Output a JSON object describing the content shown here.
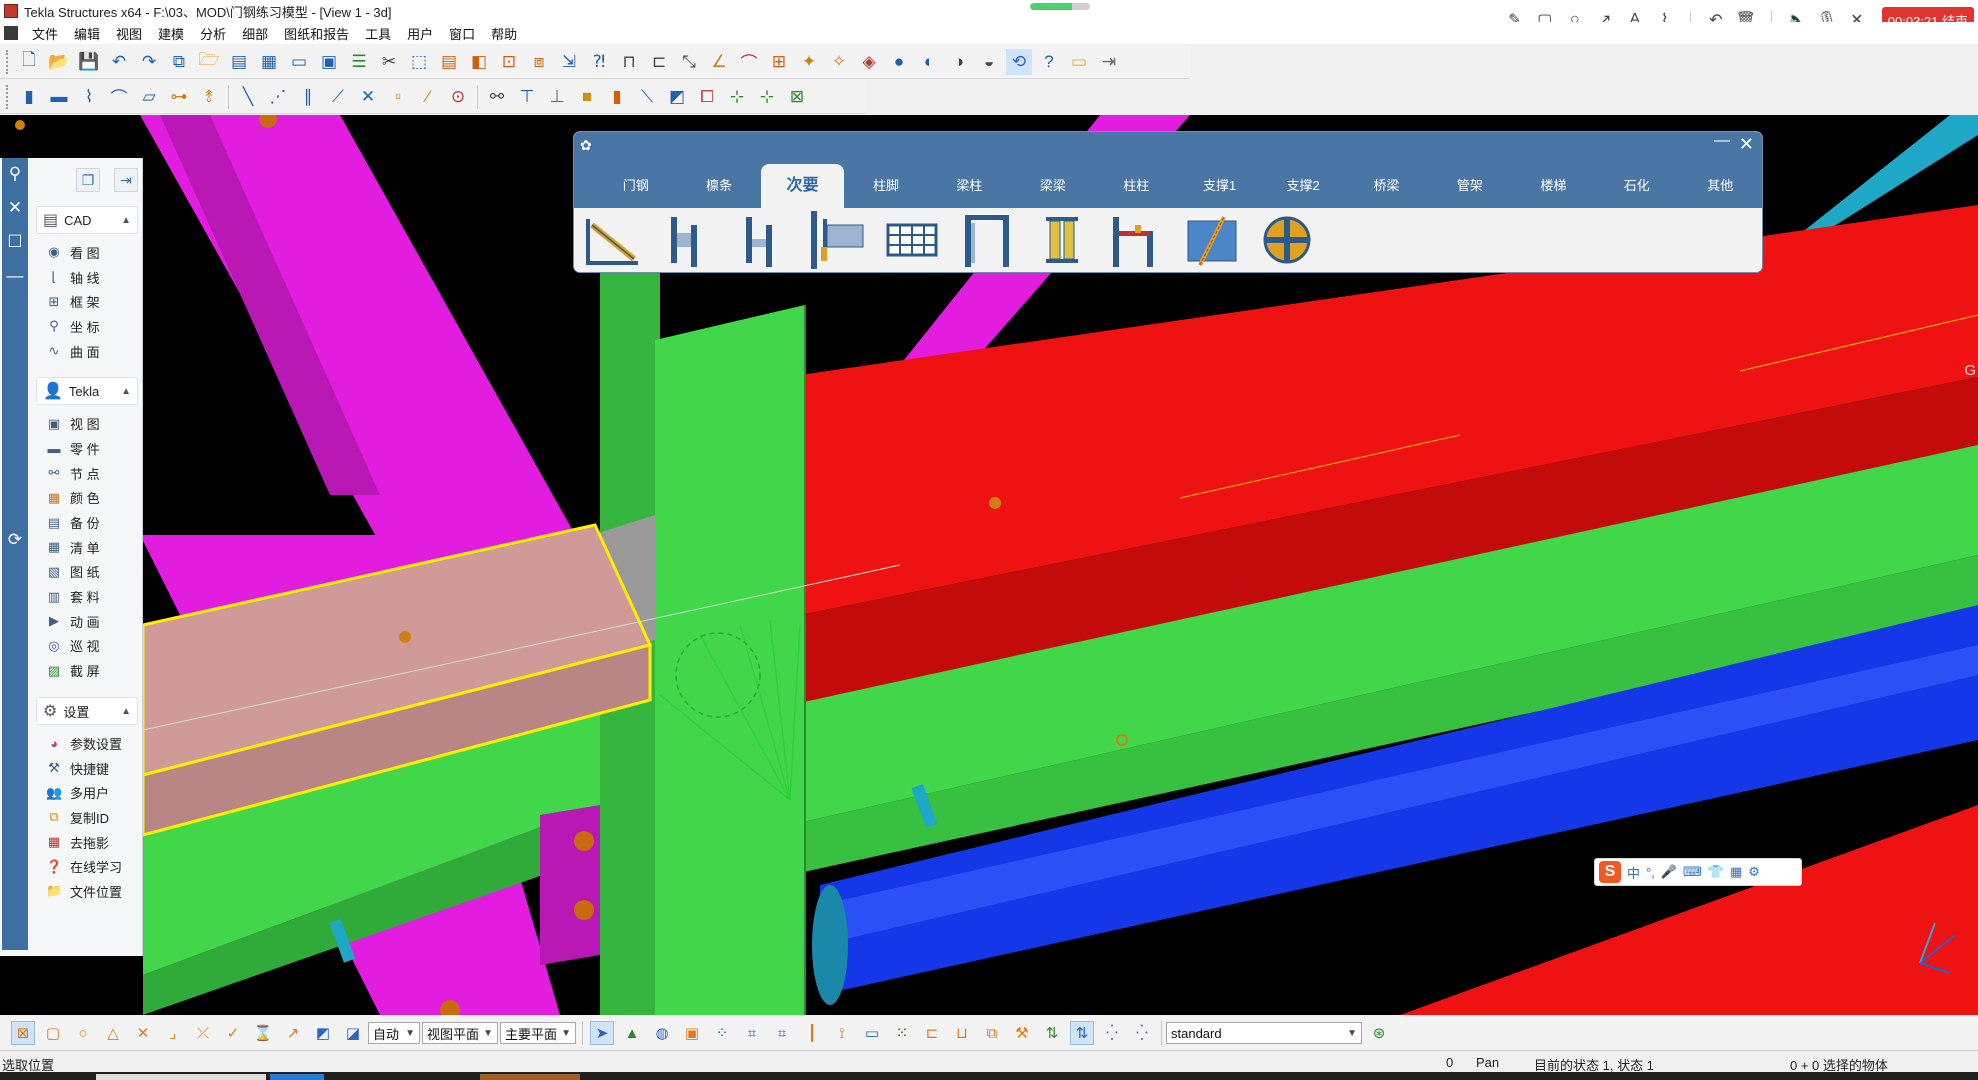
{
  "window": {
    "title": "Tekla Structures x64 - F:\\03、MOD\\门钢练习模型  - [View 1 - 3d]"
  },
  "recorder": {
    "tools": [
      "pen-icon",
      "rectangle-icon",
      "circle-icon",
      "arrow-icon",
      "text-icon",
      "highlighter-icon",
      "undo-icon",
      "trash-icon",
      "speaker-icon",
      "microphone-icon",
      "close-icon"
    ],
    "timer": "00:03:21 结束"
  },
  "menubar": {
    "items": [
      "文件",
      "编辑",
      "视图",
      "建模",
      "分析",
      "细部",
      "图纸和报告",
      "工具",
      "用户",
      "窗口",
      "帮助"
    ]
  },
  "sidebar": {
    "strip_buttons": [
      "pin-icon",
      "close-icon",
      "restore-icon",
      "minimize-icon",
      "refresh-icon"
    ],
    "groups": [
      {
        "title": "CAD",
        "items": [
          {
            "label": "看 图",
            "icon": "eye-icon"
          },
          {
            "label": "轴 线",
            "icon": "axis-icon"
          },
          {
            "label": "框 架",
            "icon": "frame-icon"
          },
          {
            "label": "坐 标",
            "icon": "location-pin-icon"
          },
          {
            "label": "曲 面",
            "icon": "curve-icon"
          }
        ]
      },
      {
        "title": "Tekla",
        "items": [
          {
            "label": "视 图",
            "icon": "view-icon"
          },
          {
            "label": "零 件",
            "icon": "part-icon"
          },
          {
            "label": "节 点",
            "icon": "binoculars-icon"
          },
          {
            "label": "颜 色",
            "icon": "color-grid-icon"
          },
          {
            "label": "备 份",
            "icon": "backup-icon"
          },
          {
            "label": "清 单",
            "icon": "list-icon"
          },
          {
            "label": "图 纸",
            "icon": "drawing-icon"
          },
          {
            "label": "套 料",
            "icon": "nesting-icon"
          },
          {
            "label": "动 画",
            "icon": "animation-icon"
          },
          {
            "label": "巡 视",
            "icon": "patrol-icon"
          },
          {
            "label": "截 屏",
            "icon": "screenshot-icon"
          }
        ]
      },
      {
        "title": "设置",
        "items": [
          {
            "label": "参数设置",
            "icon": "color-wheel-icon"
          },
          {
            "label": "快捷键",
            "icon": "tools-icon"
          },
          {
            "label": "多用户",
            "icon": "users-icon"
          },
          {
            "label": "复制ID",
            "icon": "copy-icon"
          },
          {
            "label": "去拖影",
            "icon": "remove-shadow-icon"
          },
          {
            "label": "在线学习",
            "icon": "help-icon"
          },
          {
            "label": "文件位置",
            "icon": "folder-icon"
          }
        ]
      }
    ]
  },
  "catalog": {
    "tabs": [
      "门钢",
      "檩条",
      "次要",
      "柱脚",
      "梁柱",
      "梁梁",
      "柱柱",
      "支撑1",
      "支撑2",
      "桥梁",
      "管架",
      "楼梯",
      "石化",
      "其他"
    ],
    "active_tab": "次要",
    "items": [
      "brace-connection-icon",
      "stiffener-plate-icon",
      "stiffener-plate-2-icon",
      "end-plate-icon",
      "grating-icon",
      "portal-frame-icon",
      "double-column-icon",
      "column-bracket-icon",
      "diagonal-brace-icon",
      "round-plate-icon"
    ]
  },
  "ime": {
    "mode": "中",
    "buttons": [
      "°,",
      "mic-icon",
      "keyboard-icon",
      "skin-icon",
      "grid-icon",
      "settings-icon"
    ]
  },
  "bottombar": {
    "select_auto": "自动",
    "select_view_plane": "视图平面",
    "select_main_plane": "主要平面",
    "select_standard": "standard"
  },
  "statusbar": {
    "left": "选取位置",
    "count": "0",
    "mode": "Pan",
    "state": "目前的状态 1, 状态 1",
    "selection": "0 + 0 选择的物体"
  },
  "viewport": {
    "corner_label": "G"
  },
  "colors": {
    "beam_green": "#3fd14a",
    "beam_red": "#ee1212",
    "beam_magenta": "#e21de0",
    "beam_blue": "#1437e8",
    "selected_beam": "#cf9a98",
    "catalog_header": "#4a76a6",
    "sidebar_strip": "#3d6fa0"
  }
}
